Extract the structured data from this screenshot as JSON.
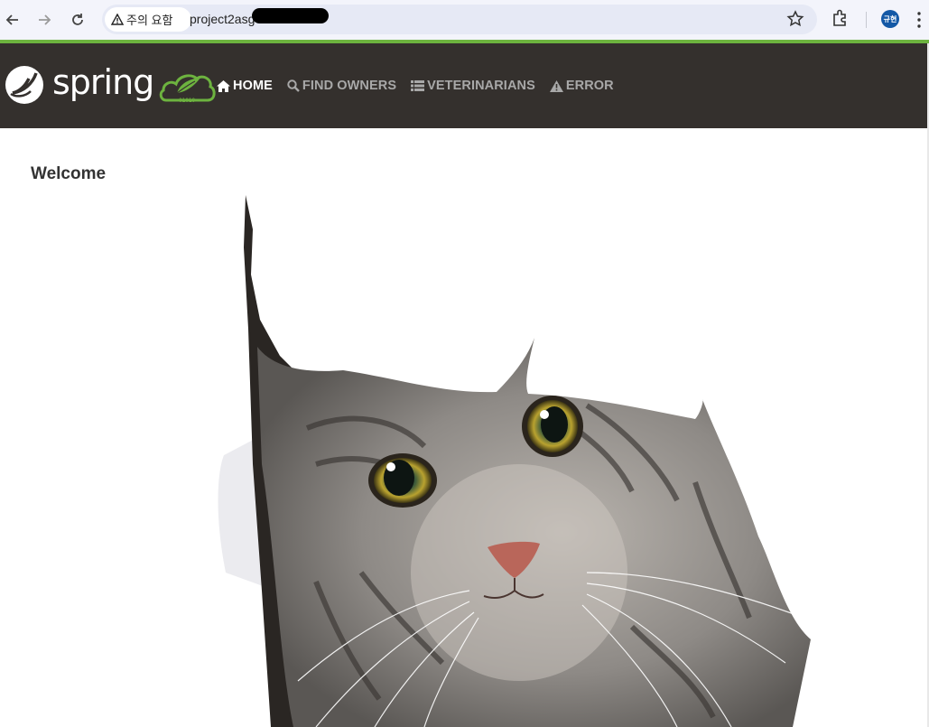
{
  "browser": {
    "security_label": "주의 요함",
    "url_visible": "project2asg",
    "profile_initials": "규현"
  },
  "navbar": {
    "brand": "spring",
    "links": [
      {
        "label": "HOME",
        "icon": "home-icon",
        "active": true
      },
      {
        "label": "FIND OWNERS",
        "icon": "search-icon",
        "active": false
      },
      {
        "label": "VETERINARIANS",
        "icon": "list-icon",
        "active": false
      },
      {
        "label": "ERROR",
        "icon": "warning-icon",
        "active": false
      }
    ]
  },
  "main": {
    "heading": "Welcome",
    "image": "pets-cat-image"
  },
  "colors": {
    "accent": "#6db33f",
    "navbar_bg": "#34302d",
    "chrome_bg": "#f3f4fb"
  }
}
